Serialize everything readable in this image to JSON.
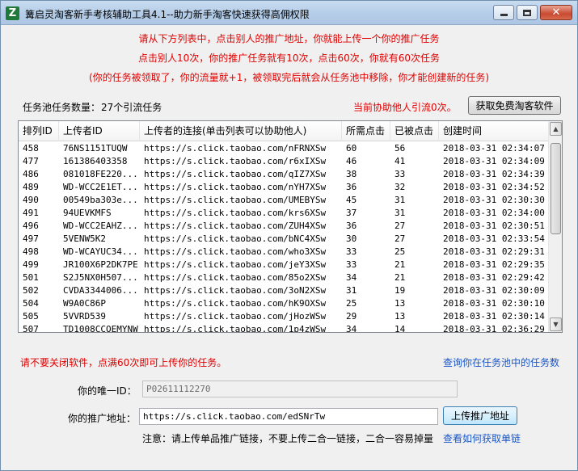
{
  "window": {
    "title": "篝启灵淘客新手考核辅助工具4.1--助力新手淘客快速获得高佣权限"
  },
  "notices": [
    "请从下方列表中，点击别人的推广地址，你就能上传一个你的推广任务",
    "点击别人10次，你的推广任务就有10次，点击60次，你就有60次任务",
    "(你的任务被领取了，你的流量就+1，被领取完后就会从任务池中移除，你才能创建新的任务)"
  ],
  "pool": {
    "count_label": "任务池任务数量：",
    "count_value": "27个引流任务",
    "helped_text": "当前协助他人引流0次。",
    "get_software_button": "获取免费淘客软件"
  },
  "table": {
    "headers": [
      "排列ID",
      "上传者ID",
      "上传者的连接(单击列表可以协助他人)",
      "所需点击",
      "已被点击",
      "创建时间"
    ],
    "rows": [
      [
        "458",
        "76NS1151TUQW",
        "https://s.click.taobao.com/nFRNXSw",
        "60",
        "56",
        "2018-03-31  02:34:07"
      ],
      [
        "477",
        "161386403358",
        "https://s.click.taobao.com/r6xIXSw",
        "46",
        "41",
        "2018-03-31  02:34:09"
      ],
      [
        "486",
        "081018FE220...",
        "https://s.click.taobao.com/qIZ7XSw",
        "38",
        "33",
        "2018-03-31  02:34:39"
      ],
      [
        "489",
        "WD-WCC2E1ET...",
        "https://s.click.taobao.com/nYH7XSw",
        "36",
        "32",
        "2018-03-31  02:34:52"
      ],
      [
        "490",
        "00549ba303e...",
        "https://s.click.taobao.com/UMEBYSw",
        "45",
        "31",
        "2018-03-31  02:30:30"
      ],
      [
        "491",
        "94UEVKMFS",
        "https://s.click.taobao.com/krs6XSw",
        "37",
        "31",
        "2018-03-31  02:34:00"
      ],
      [
        "496",
        "WD-WCC2EAHZ...",
        "https://s.click.taobao.com/ZUH4XSw",
        "36",
        "27",
        "2018-03-31  02:30:51"
      ],
      [
        "497",
        "5VENW5K2",
        "https://s.click.taobao.com/bNC4XSw",
        "30",
        "27",
        "2018-03-31  02:33:54"
      ],
      [
        "498",
        "WD-WCAYUC34...",
        "https://s.click.taobao.com/who3XSw",
        "33",
        "25",
        "2018-03-31  02:29:31"
      ],
      [
        "499",
        "JR100X6P2DK7PE",
        "https://s.click.taobao.com/jeY3XSw",
        "33",
        "21",
        "2018-03-31  02:29:35"
      ],
      [
        "501",
        "S2J5NX0H507...",
        "https://s.click.taobao.com/85o2XSw",
        "34",
        "21",
        "2018-03-31  02:29:42"
      ],
      [
        "502",
        "CVDA3344006...",
        "https://s.click.taobao.com/3oN2XSw",
        "31",
        "19",
        "2018-03-31  02:30:09"
      ],
      [
        "504",
        "W9A0C86P",
        "https://s.click.taobao.com/hK9OXSw",
        "25",
        "13",
        "2018-03-31  02:30:10"
      ],
      [
        "505",
        "5VVRD539",
        "https://s.click.taobao.com/jHozWSw",
        "29",
        "13",
        "2018-03-31  02:30:14"
      ],
      [
        "507",
        "TD1008CCOEMYNW",
        "https://s.click.taobao.com/1p4zWSw",
        "34",
        "14",
        "2018-03-31  02:36:29"
      ]
    ]
  },
  "footer": {
    "warning": "请不要关闭软件，点满60次即可上传你的任务。",
    "query_link": "查询你在任务池中的任务数",
    "unique_id_label": "你的唯一ID：",
    "unique_id_value": "P02611112270",
    "promo_label": "你的推广地址：",
    "promo_value": "https://s.click.taobao.com/edSNrTw",
    "upload_button": "上传推广地址",
    "note": "注意：请上传单品推广链接，不要上传二合一链接，二合一容易掉量",
    "howto_link": "查看如何获取单链"
  },
  "icons": {
    "app": "Z",
    "close": "✕",
    "scroll_up": "▲",
    "scroll_down": "▼"
  }
}
